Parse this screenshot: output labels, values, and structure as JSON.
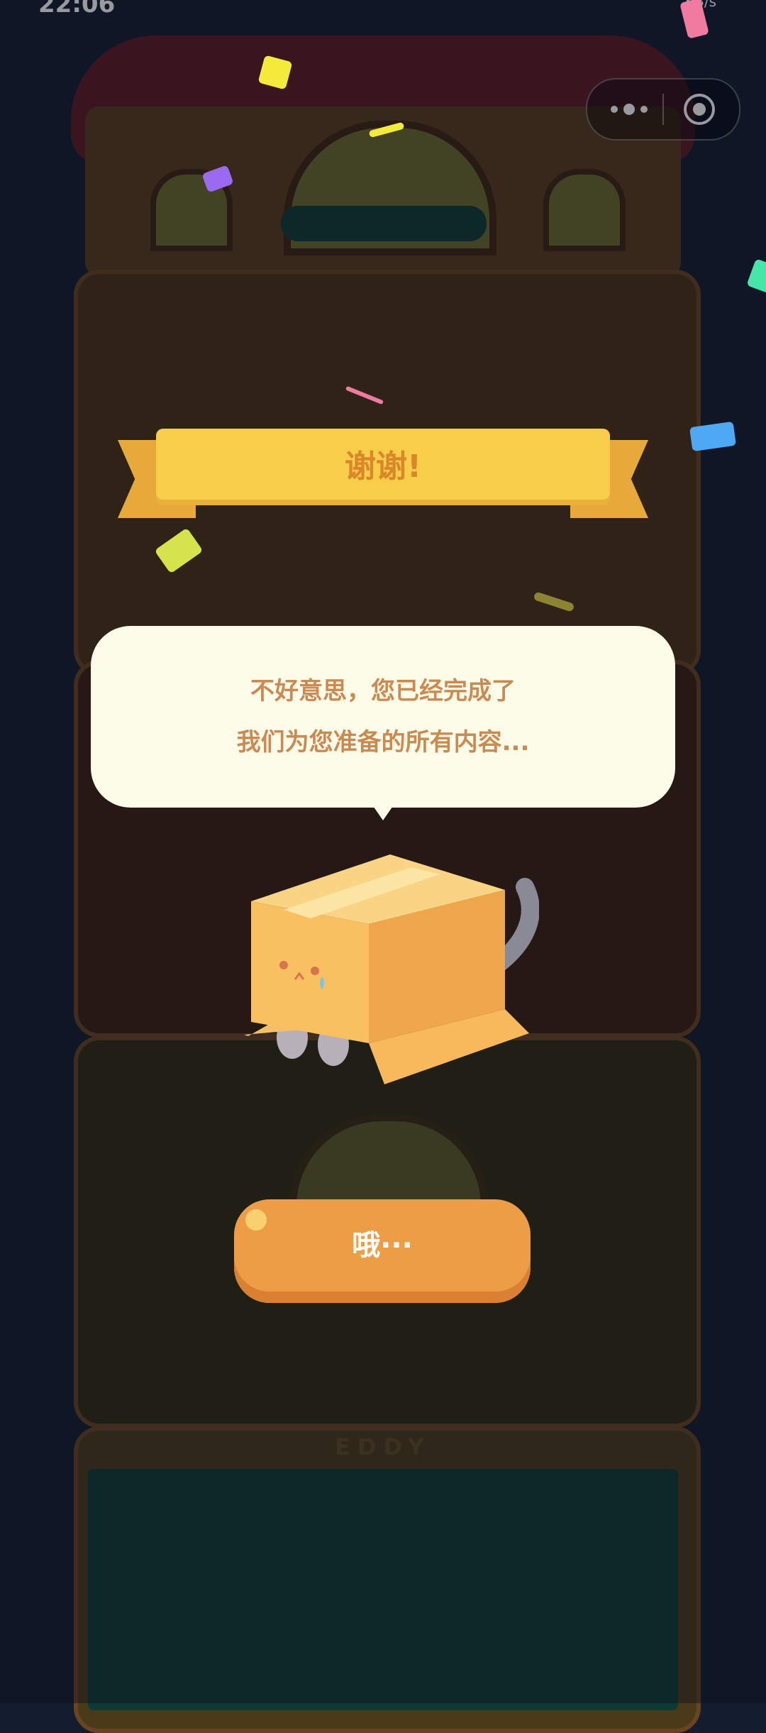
{
  "status_bar": {
    "time": "22:06",
    "network_speed": "KB/s"
  },
  "capsule": {
    "more_icon": "more-dots-icon",
    "close_icon": "target-close-icon"
  },
  "building": {
    "sign": "EDDY"
  },
  "ribbon": {
    "title": "谢谢!"
  },
  "dialog": {
    "line_1": "不好意思，您已经完成了",
    "line_2": "我们为您准备的所有内容..."
  },
  "action": {
    "label": "哦···"
  },
  "colors": {
    "background": "#141d30",
    "ribbon": "#f8cd4a",
    "ribbon_text": "#d9872a",
    "bubble": "#fcfce8",
    "bubble_text": "#c98a54",
    "button": "#ee9d47",
    "box": "#f5b557"
  }
}
